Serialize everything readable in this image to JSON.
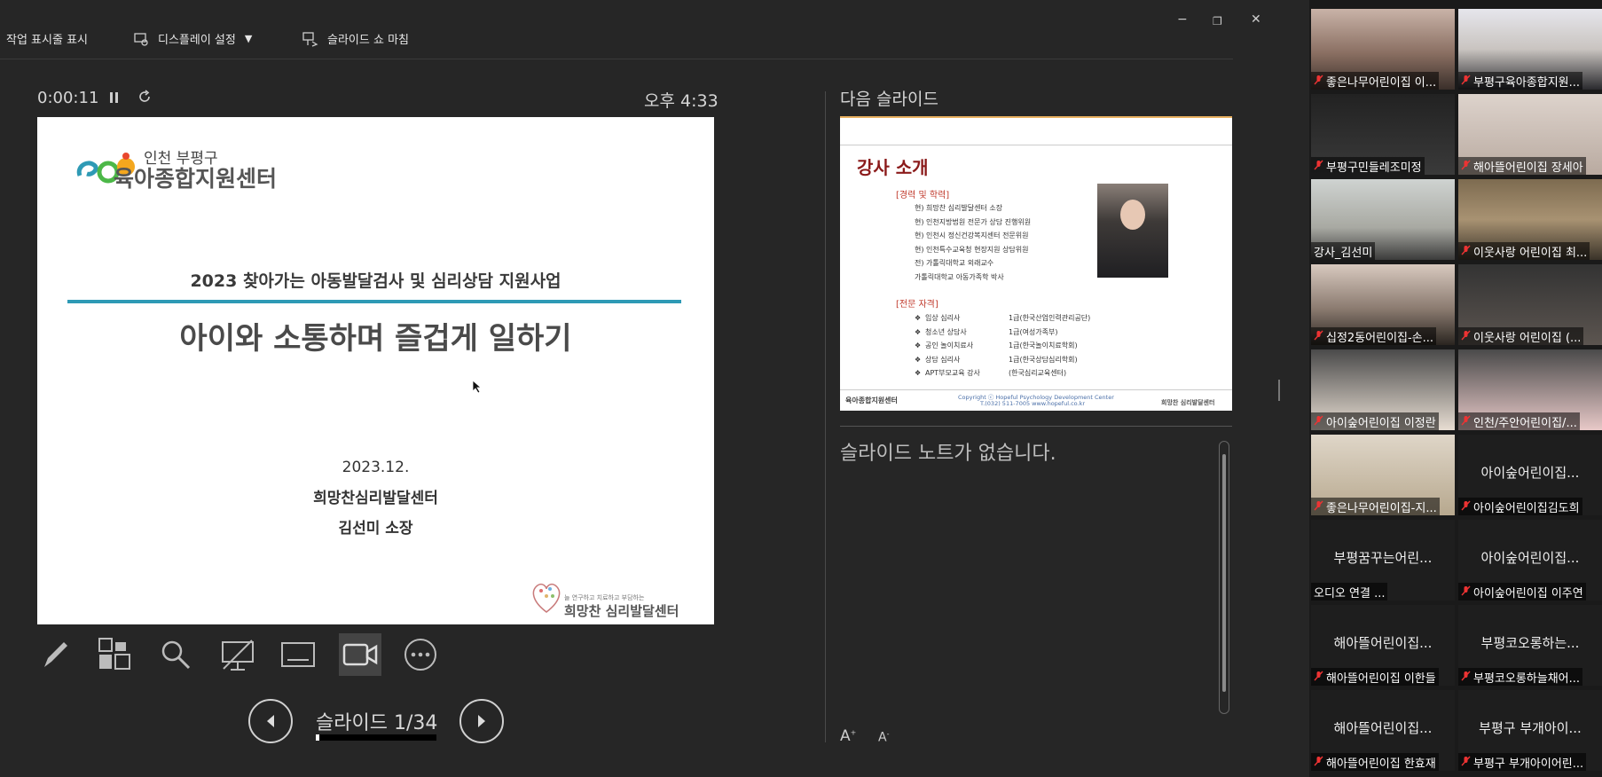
{
  "toolbar": {
    "show_taskbar": "작업 표시줄 표시",
    "display_settings": "디스플레이 설정",
    "end_show": "슬라이드 쇼 마침",
    "minimize": "−",
    "restore": "❐",
    "close": "✕"
  },
  "presenter": {
    "timer": "0:00:11",
    "pause_icon": "pause-icon",
    "reset_icon": "reset-icon",
    "clock": "오후 4:33",
    "next_slide_label": "다음 슬라이드",
    "notes": "슬라이드 노트가 없습니다.",
    "slide_counter": "슬라이드 1/34",
    "progress_fraction": 0.029
  },
  "current_slide": {
    "logo_line1": "인천 부평구",
    "logo_line2": "육아종합지원센터",
    "subtitle": "2023 찾아가는 아동발달검사 및 심리상담 지원사업",
    "title": "아이와 소통하며 즐겁게 일하기",
    "date": "2023.12.",
    "org": "희망찬심리발달센터",
    "presenter": "김선미 소장",
    "footer_tag": "늘 연구하고 치료하고 부담하는",
    "footer_name": "희망찬 심리발달센터",
    "accent_color": "#2e9ab5"
  },
  "next_slide": {
    "title": "강사 소개",
    "section1": "[경력 및 학력]",
    "career": [
      "현) 희망찬 심리발달센터 소장",
      "현) 인천지방법원 전문가 상담 진행위원",
      "현) 인천시 정신건강복지센터 전문위원",
      "현) 인천특수교육청 현장지원 상담위원",
      "전) 가톨릭대학교 외래교수",
      "가톨릭대학교 아동가족학 박사"
    ],
    "section2": "[전문 자격]",
    "quals": [
      {
        "name": "임상 심리사",
        "grade": "1급(한국산업인력관리공단)"
      },
      {
        "name": "청소년 상담사",
        "grade": "1급(여성가족부)"
      },
      {
        "name": "공인 놀이치료사",
        "grade": "1급(한국놀이치료학회)"
      },
      {
        "name": "상담 심리사",
        "grade": "1급(한국상담심리학회)"
      },
      {
        "name": "APT부모교육 강사",
        "grade": "(한국심리교육센터)"
      }
    ],
    "footer_logo": "육아종합지원센터",
    "copyright": "Copyright ⓒ Hopeful Psychology Development Center",
    "contact": "T.(032) 511-7005  www.hopeful.co.kr",
    "footer_right": "희망찬 심리발달센터",
    "title_color": "#8b1a1a",
    "section_color": "#c0392b"
  },
  "participants": [
    {
      "name": "좋은나무어린이집 이...",
      "video": true,
      "muted": true
    },
    {
      "name": "부평구육아종합지원...",
      "video": true,
      "muted": true
    },
    {
      "name": "부평구민들레조미정",
      "video": true,
      "muted": true
    },
    {
      "name": "해아뜰어린이집 장세아",
      "video": true,
      "muted": true
    },
    {
      "name": "강사_김선미",
      "video": true,
      "muted": false,
      "active": true
    },
    {
      "name": "이웃사랑 어린이집 최...",
      "video": true,
      "muted": true
    },
    {
      "name": "십정2동어린이집-손...",
      "video": true,
      "muted": true
    },
    {
      "name": "이웃사랑 어린이집 (...",
      "video": true,
      "muted": true
    },
    {
      "name": "아이숲어린이집 이정란",
      "video": true,
      "muted": true
    },
    {
      "name": "인천/주안어린이집/...",
      "video": true,
      "muted": true
    },
    {
      "name": "좋은나무어린이집-지...",
      "video": true,
      "muted": true
    },
    {
      "name": "아이숲어린이집김도희",
      "big": "아이숲어린이집...",
      "video": false,
      "muted": true
    },
    {
      "name": "오디오 연결 ...",
      "big": "부평꿈꾸는어린...",
      "video": false,
      "muted": false
    },
    {
      "name": "아이숲어린이집 이주연",
      "big": "아이숲어린이집...",
      "video": false,
      "muted": true
    },
    {
      "name": "해아뜰어린이집 이한들",
      "big": "해아뜰어린이집...",
      "video": false,
      "muted": true
    },
    {
      "name": "부평코오롱하늘채어...",
      "big": "부평코오롱하는...",
      "video": false,
      "muted": true
    },
    {
      "name": "해아뜰어린이집 한효재",
      "big": "해아뜰어린이집...",
      "video": false,
      "muted": true
    },
    {
      "name": "부평구 부개아이어린...",
      "big": "부평구 부개아이...",
      "video": false,
      "muted": true
    }
  ]
}
